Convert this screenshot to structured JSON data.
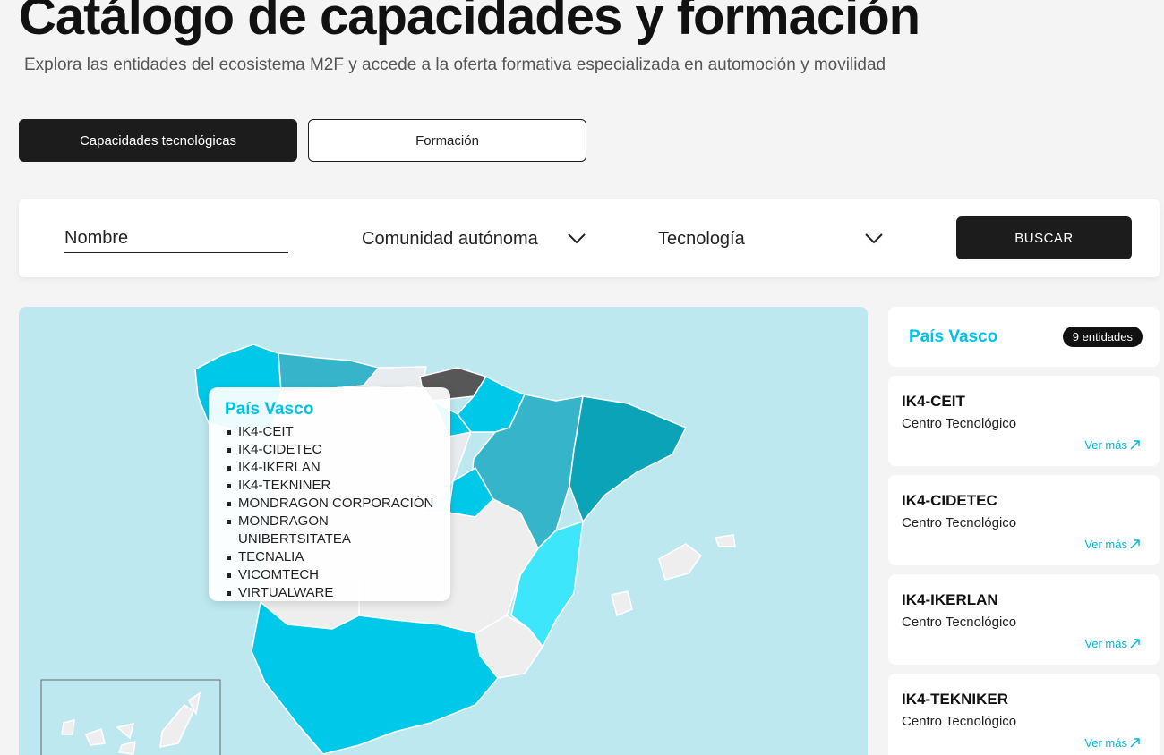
{
  "header": {
    "title": "Catálogo de capacidades y formación",
    "subtitle": "Explora las entidades del ecosistema M2F y accede a la oferta formativa especializada en automoción y movilidad"
  },
  "tabs": [
    {
      "label": "Capacidades tecnológicas",
      "active": true
    },
    {
      "label": "Formación",
      "active": false
    }
  ],
  "filters": {
    "name_placeholder": "Nombre",
    "ccaa_label": "Comunidad autónoma",
    "tech_label": "Tecnología",
    "search_label": "BUSCAR"
  },
  "colors": {
    "accent": "#00c2e6",
    "dark": "#1c1c1c",
    "selected_region": "#555555",
    "map_bg": "#bde8ef"
  },
  "map": {
    "tooltip": {
      "title": "País Vasco",
      "items": [
        "IK4-CEIT",
        "IK4-CIDETEC",
        "IK4-IKERLAN",
        "IK4-TEKNINER",
        "MONDRAGON CORPORACIÓN",
        "MONDRAGON UNIBERTSITATEA",
        "TECNALIA",
        "VICOMTECH",
        "VIRTUALWARE"
      ]
    }
  },
  "sidebar": {
    "region": "País Vasco",
    "count": "9 entidades",
    "entities": [
      {
        "name": "IK4-CEIT",
        "type": "Centro Tecnológico",
        "link": "Ver más"
      },
      {
        "name": "IK4-CIDETEC",
        "type": "Centro Tecnológico",
        "link": "Ver más"
      },
      {
        "name": "IK4-IKERLAN",
        "type": "Centro Tecnológico",
        "link": "Ver más"
      },
      {
        "name": "IK4-TEKNIKER",
        "type": "Centro Tecnológico",
        "link": "Ver más"
      }
    ]
  }
}
